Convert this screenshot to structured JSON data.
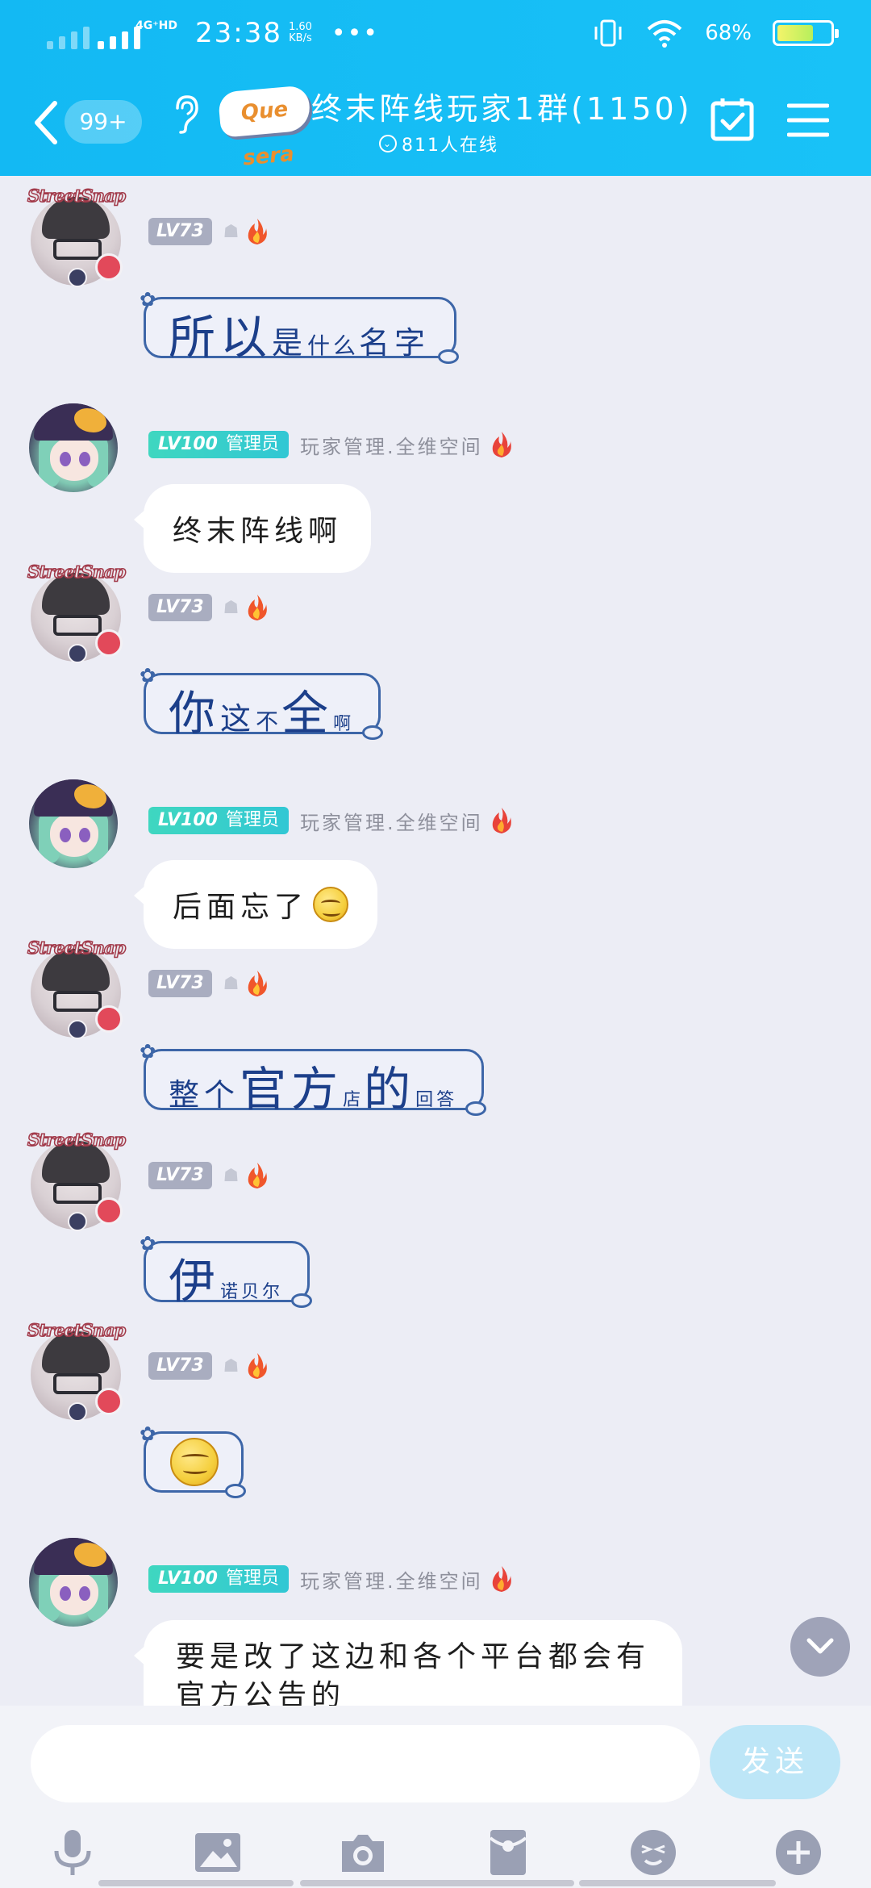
{
  "status_bar": {
    "network": "4G⁺HD",
    "time": "23:38",
    "speed_value": "1.60",
    "speed_unit": "KB/s",
    "more": "•••",
    "battery_percent": "68%",
    "battery_level": 0.68
  },
  "header": {
    "unread_badge": "99+",
    "group_logo": "Que sera",
    "group_title": "终末阵线玩家1群(1150)",
    "online_text": "811人在线"
  },
  "messages": [
    {
      "avatar": "streetsnap",
      "avatar_label": "StreetSnap",
      "level": "LV73",
      "segments": [
        {
          "t": "所以",
          "s": "big"
        },
        {
          "t": "是",
          "s": "mid"
        },
        {
          "t": "什么",
          "s": "sm"
        },
        {
          "t": "名字",
          "s": "mid"
        }
      ]
    },
    {
      "avatar": "anime",
      "level": "LV100",
      "role": "管理员",
      "title": "玩家管理.全维空间",
      "text": "终末阵线啊"
    },
    {
      "avatar": "streetsnap",
      "avatar_label": "StreetSnap",
      "level": "LV73",
      "segments": [
        {
          "t": "你",
          "s": "big"
        },
        {
          "t": "这",
          "s": "mid"
        },
        {
          "t": "不",
          "s": "sm"
        },
        {
          "t": "全",
          "s": "big"
        },
        {
          "t": "啊",
          "s": "xs"
        }
      ]
    },
    {
      "avatar": "anime",
      "level": "LV100",
      "role": "管理员",
      "title": "玩家管理.全维空间",
      "text": "后面忘了"
    },
    {
      "avatar": "streetsnap",
      "avatar_label": "StreetSnap",
      "level": "LV73",
      "segments": [
        {
          "t": "整",
          "s": "mid"
        },
        {
          "t": "个",
          "s": "mid"
        },
        {
          "t": "官",
          "s": "big"
        },
        {
          "t": "方",
          "s": "big"
        },
        {
          "t": "店",
          "s": "xs"
        },
        {
          "t": "的",
          "s": "big"
        },
        {
          "t": "回答",
          "s": "xs"
        }
      ]
    },
    {
      "avatar": "streetsnap",
      "avatar_label": "StreetSnap",
      "level": "LV73",
      "segments": [
        {
          "t": "伊",
          "s": "big"
        },
        {
          "t": "诺贝尔",
          "s": "xs"
        }
      ]
    },
    {
      "avatar": "streetsnap",
      "avatar_label": "StreetSnap",
      "level": "LV73",
      "segments": []
    },
    {
      "avatar": "anime",
      "level": "LV100",
      "role": "管理员",
      "title": "玩家管理.全维空间",
      "text_line1": "要是改了这边和各个平台都会有",
      "text_line2": "官方公告的"
    }
  ],
  "input": {
    "placeholder": "",
    "send_label": "发送"
  },
  "icons": {
    "voice": "microphone-icon",
    "image": "image-icon",
    "camera": "camera-icon",
    "red_packet": "red-packet-icon",
    "emoji": "emoji-icon",
    "more": "plus-icon"
  },
  "colors": {
    "header": "#19c2f7",
    "admin_badge": "#3fd7c0",
    "level_badge": "#a9adc0",
    "bubble_border": "#3d66a8",
    "background": "#ecedf5"
  }
}
